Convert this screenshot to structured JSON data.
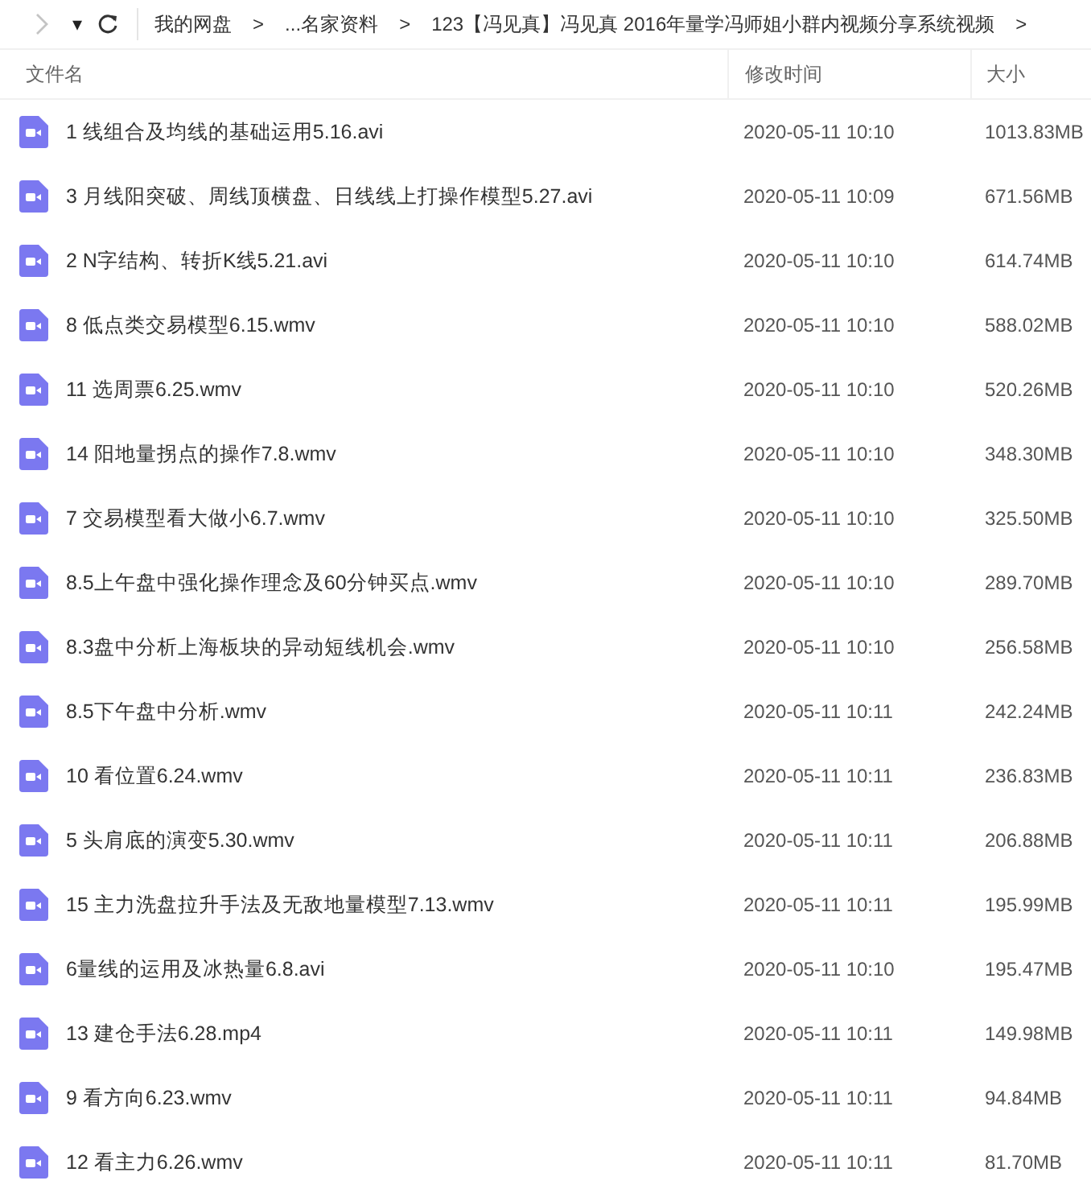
{
  "toolbar": {
    "dropdown": "▾",
    "breadcrumbs": [
      {
        "label": "我的网盘",
        "separator": ">"
      },
      {
        "label": "..."
      },
      {
        "label": "名家资料",
        "separator": ">"
      },
      {
        "label": "123【冯见真】冯见真 2016年量学冯师姐小群内视频分享系统视频",
        "separator": ">"
      }
    ]
  },
  "table": {
    "columns": [
      "文件名",
      "修改时间",
      "大小"
    ],
    "rows": [
      {
        "name": "1 线组合及均线的基础运用5.16.avi",
        "modified": "2020-05-11 10:10",
        "size": "1013.83MB"
      },
      {
        "name": "3 月线阳突破、周线顶横盘、日线线上打操作模型5.27.avi",
        "modified": "2020-05-11 10:09",
        "size": "671.56MB"
      },
      {
        "name": "2 N字结构、转折K线5.21.avi",
        "modified": "2020-05-11 10:10",
        "size": "614.74MB"
      },
      {
        "name": "8 低点类交易模型6.15.wmv",
        "modified": "2020-05-11 10:10",
        "size": "588.02MB"
      },
      {
        "name": "11 选周票6.25.wmv",
        "modified": "2020-05-11 10:10",
        "size": "520.26MB"
      },
      {
        "name": "14 阳地量拐点的操作7.8.wmv",
        "modified": "2020-05-11 10:10",
        "size": "348.30MB"
      },
      {
        "name": "7 交易模型看大做小6.7.wmv",
        "modified": "2020-05-11 10:10",
        "size": "325.50MB"
      },
      {
        "name": "8.5上午盘中强化操作理念及60分钟买点.wmv",
        "modified": "2020-05-11 10:10",
        "size": "289.70MB"
      },
      {
        "name": "8.3盘中分析上海板块的异动短线机会.wmv",
        "modified": "2020-05-11 10:10",
        "size": "256.58MB"
      },
      {
        "name": "8.5下午盘中分析.wmv",
        "modified": "2020-05-11 10:11",
        "size": "242.24MB"
      },
      {
        "name": "10 看位置6.24.wmv",
        "modified": "2020-05-11 10:11",
        "size": "236.83MB"
      },
      {
        "name": "5 头肩底的演变5.30.wmv",
        "modified": "2020-05-11 10:11",
        "size": "206.88MB"
      },
      {
        "name": "15 主力洗盘拉升手法及无敌地量模型7.13.wmv",
        "modified": "2020-05-11 10:11",
        "size": "195.99MB"
      },
      {
        "name": "6量线的运用及冰热量6.8.avi",
        "modified": "2020-05-11 10:10",
        "size": "195.47MB"
      },
      {
        "name": "13 建仓手法6.28.mp4",
        "modified": "2020-05-11 10:11",
        "size": "149.98MB"
      },
      {
        "name": "9 看方向6.23.wmv",
        "modified": "2020-05-11 10:11",
        "size": "94.84MB"
      },
      {
        "name": "12 看主力6.26.wmv",
        "modified": "2020-05-11 10:11",
        "size": "81.70MB"
      }
    ]
  }
}
